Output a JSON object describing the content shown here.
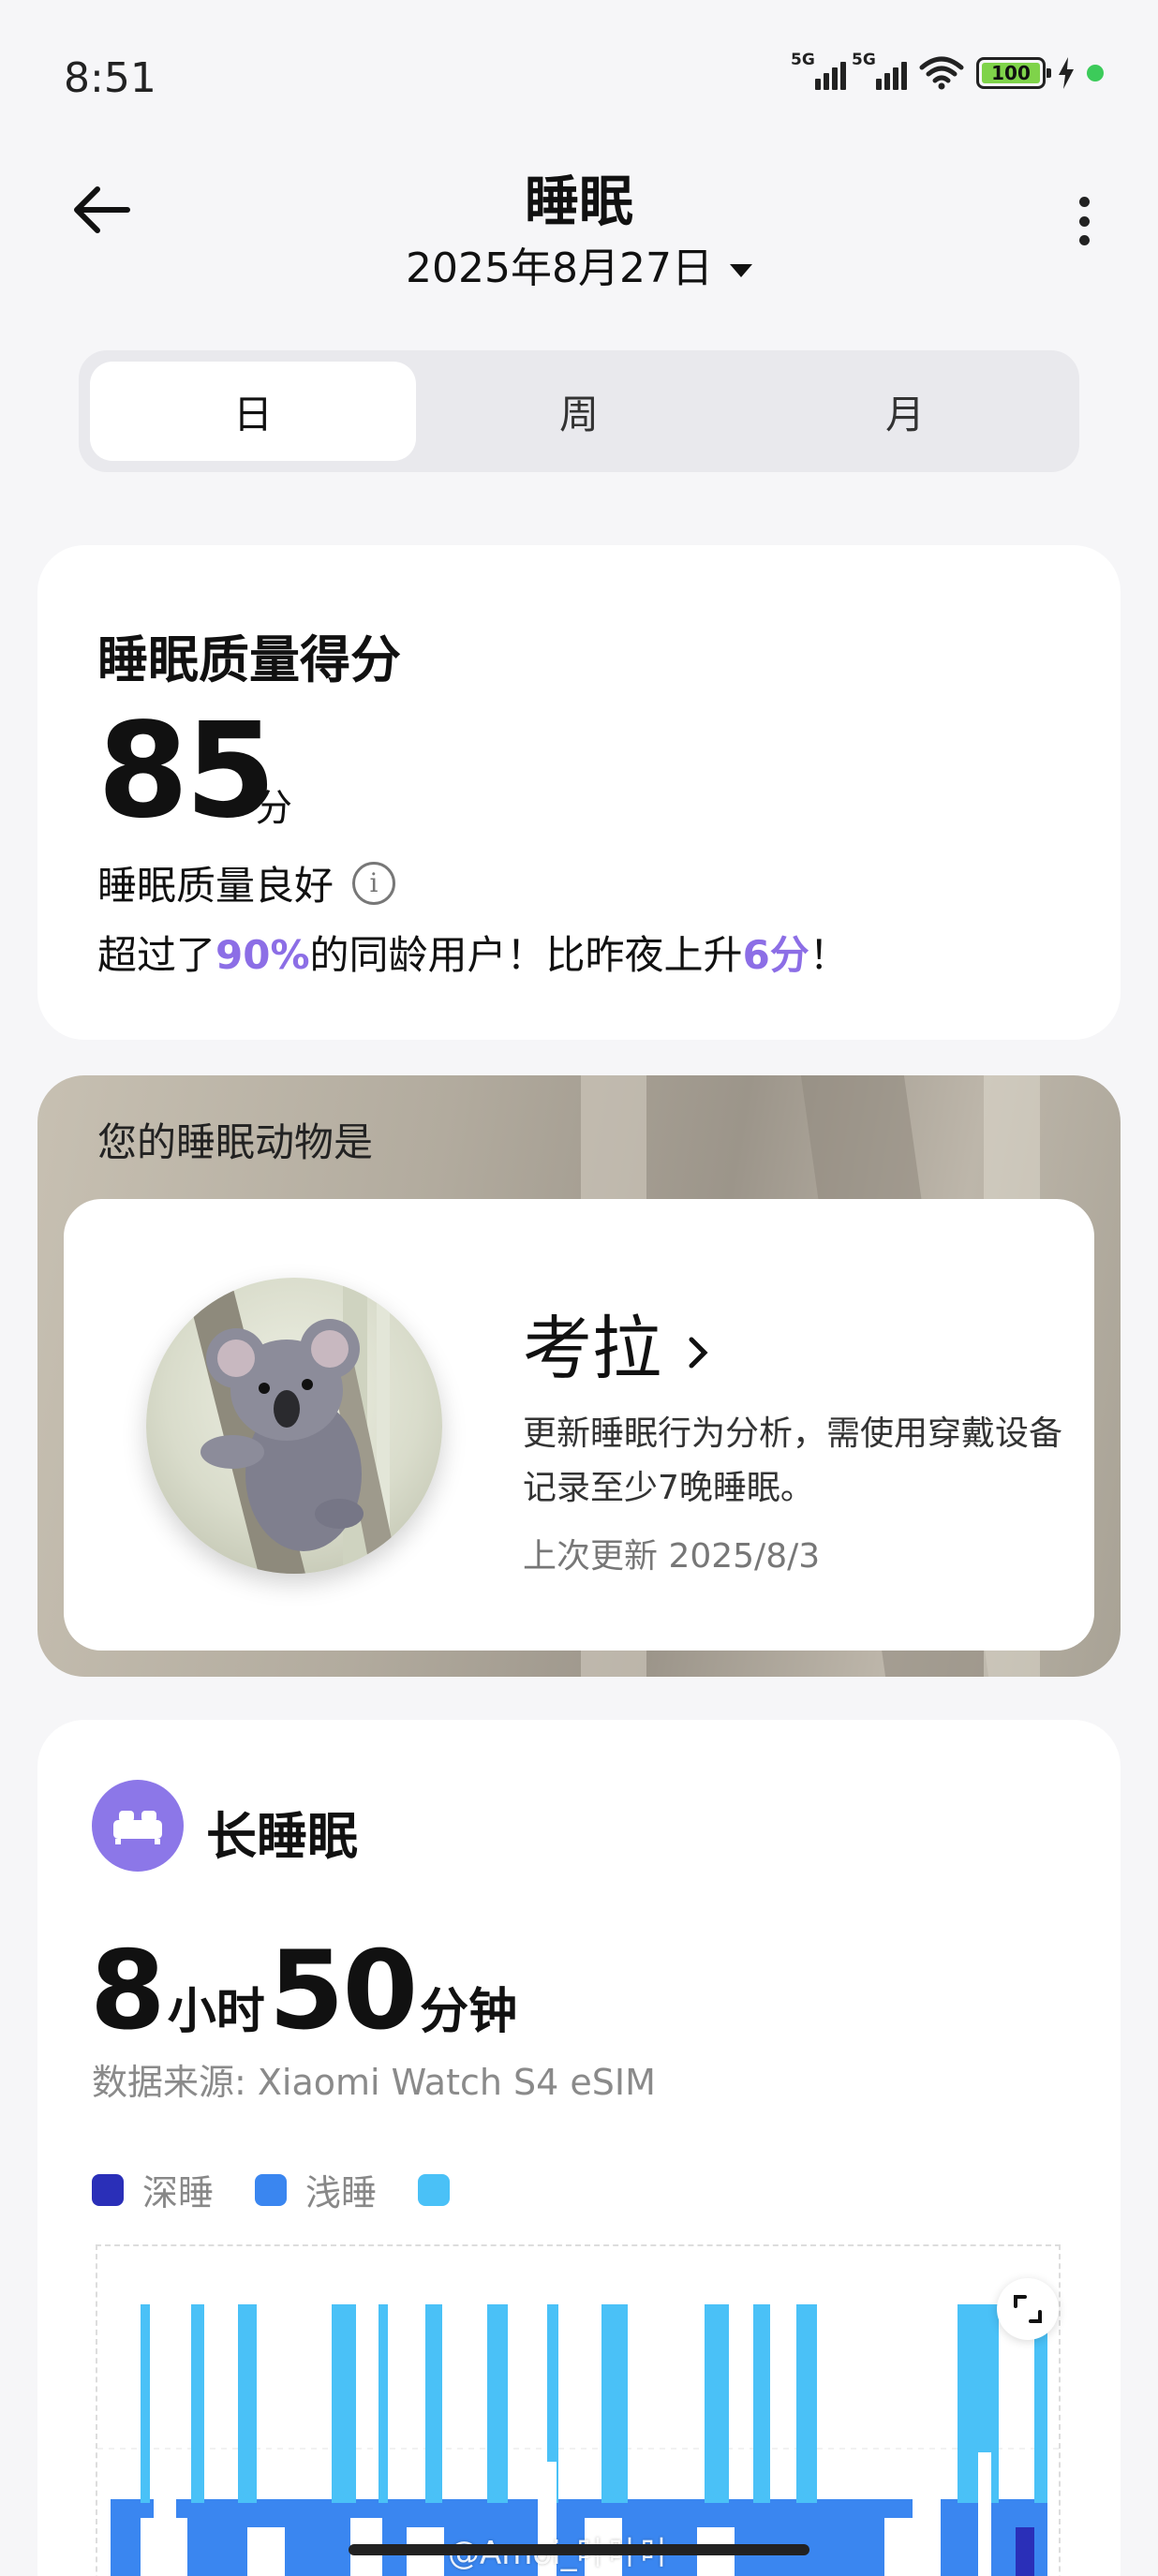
{
  "status": {
    "time": "8:51",
    "battery": "100",
    "network": "5G"
  },
  "header": {
    "title": "睡眠",
    "date": "2025年8月27日"
  },
  "tabs": [
    {
      "label": "日"
    },
    {
      "label": "周"
    },
    {
      "label": "月"
    }
  ],
  "score": {
    "title": "睡眠质量得分",
    "value": "85",
    "unit": "分",
    "quality": "睡眠质量良好",
    "line_a": "超过了",
    "percent": "90%",
    "line_b": "的同龄用户！比昨夜上升",
    "rise": "6分",
    "line_c": "！"
  },
  "animal": {
    "label": "您的睡眠动物是",
    "name": "考拉",
    "desc": "更新睡眠行为分析，需使用穿戴设备记录至少7晚睡眠。",
    "updated": "上次更新 2025/8/3"
  },
  "sleep": {
    "title": "长睡眠",
    "hours": "8",
    "hours_unit": "小时",
    "minutes": "50",
    "minutes_unit": "分钟",
    "source": "数据来源: Xiaomi Watch S4 eSIM",
    "legend": [
      {
        "label": "深睡",
        "color": "#2a2fb8"
      },
      {
        "label": "浅睡",
        "color": "#3a86f0"
      },
      {
        "label": "",
        "color": "#4ac1f7"
      }
    ]
  },
  "watermark": "@Amoi_叶叶叶",
  "colors": {
    "accent": "#8c6ee6",
    "deep": "#2a2fb8",
    "light": "#3a86f0",
    "rem": "#4ac1f7"
  }
}
